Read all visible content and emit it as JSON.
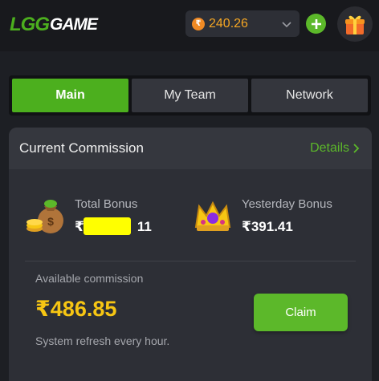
{
  "header": {
    "logo_primary": "LGG",
    "logo_secondary": "GAME",
    "currency_symbol": "₹",
    "balance": "240.26",
    "add_icon": "plus-icon",
    "gift_icon": "gift-icon"
  },
  "tabs": [
    {
      "label": "Main",
      "active": true
    },
    {
      "label": "My Team",
      "active": false
    },
    {
      "label": "Network",
      "active": false
    }
  ],
  "commission": {
    "title": "Current Commission",
    "details_label": "Details",
    "total_bonus_label": "Total Bonus",
    "total_bonus_prefix": "₹",
    "total_bonus_suffix": "11",
    "yesterday_bonus_label": "Yesterday Bonus",
    "yesterday_bonus_value": "₹391.41",
    "available_label": "Available commission",
    "available_value": "₹486.85",
    "claim_label": "Claim",
    "refresh_note": "System refresh every hour."
  },
  "colors": {
    "accent": "#4caf1e",
    "gold": "#f7c613",
    "balance": "#f5a623"
  }
}
